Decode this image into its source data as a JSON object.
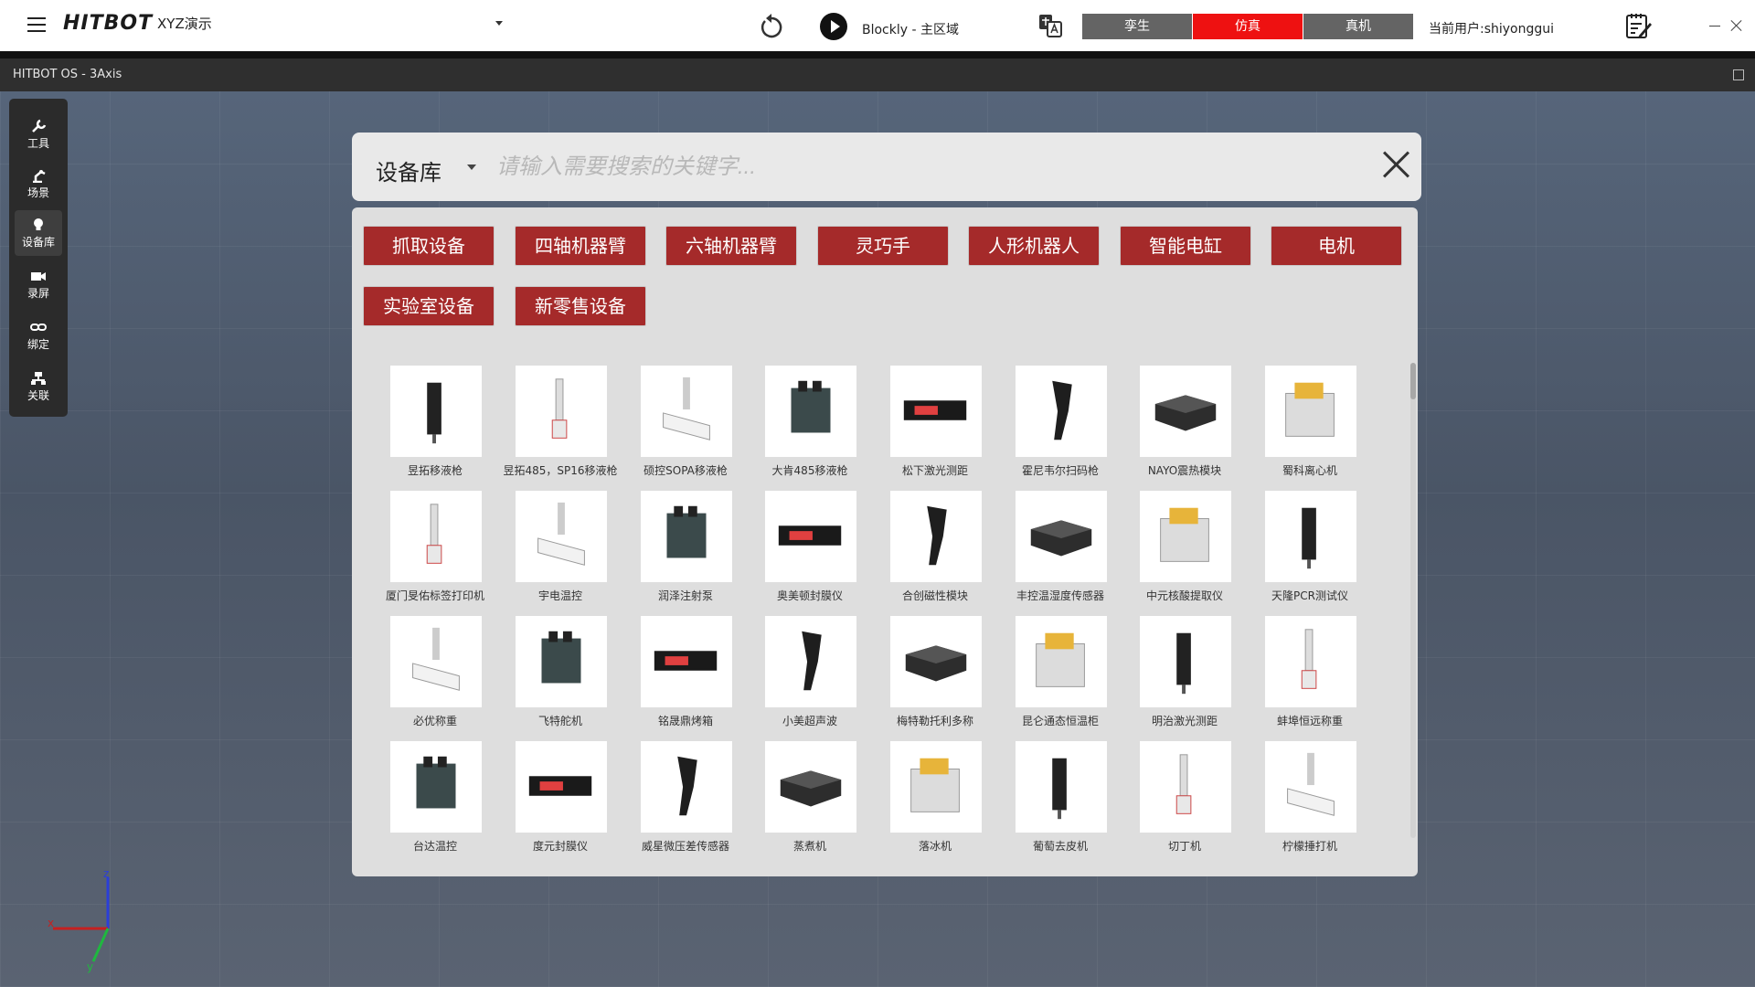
{
  "topbar": {
    "brand": "HITBOT",
    "project": "XYZ演示",
    "blockly": "Blockly - 主区域",
    "modes": [
      "孪生",
      "仿真",
      "真机"
    ],
    "active_mode": "仿真",
    "current_user": "当前用户:shiyonggui"
  },
  "subheader": {
    "title": "HITBOT OS - 3Axis"
  },
  "toolbar": {
    "items": [
      {
        "label": "工具",
        "icon": "wrench-icon"
      },
      {
        "label": "场景",
        "icon": "robot-arm-icon"
      },
      {
        "label": "设备库",
        "icon": "lightbulb-icon"
      },
      {
        "label": "录屏",
        "icon": "video-camera-icon"
      },
      {
        "label": "绑定",
        "icon": "link-icon"
      },
      {
        "label": "关联",
        "icon": "relation-icon"
      }
    ],
    "active": "设备库"
  },
  "axis": {
    "x": "x",
    "y": "y",
    "z": "z"
  },
  "library": {
    "selector": "设备库",
    "search_placeholder": "请输入需要搜索的关键字...",
    "categories": [
      "抓取设备",
      "四轴机器臂",
      "六轴机器臂",
      "灵巧手",
      "人形机器人",
      "智能电缸",
      "电机",
      "实验室设备",
      "新零售设备"
    ],
    "items": [
      "昱拓移液枪",
      "昱拓485，SP16移液枪",
      "硕控SOPA移液枪",
      "大肯485移液枪",
      "松下激光测距",
      "霍尼韦尔扫码枪",
      "NAYO震热模块",
      "蜀科离心机",
      "厦门旻佑标签打印机",
      "宇电温控",
      "润泽注射泵",
      "奥美顿封膜仪",
      "合创磁性模块",
      "丰控温湿度传感器",
      "中元核酸提取仪",
      "天隆PCR测试仪",
      "必优称重",
      "飞特舵机",
      "铭晟鼎烤箱",
      "小美超声波",
      "梅特勒托利多称",
      "昆仑通态恒温柜",
      "明治激光测距",
      "蚌埠恒远称重",
      "台达温控",
      "度元封膜仪",
      "威星微压差传感器",
      "蒸煮机",
      "落冰机",
      "葡萄去皮机",
      "切丁机",
      "柠檬捶打机"
    ]
  },
  "colors": {
    "accent": "#ee1111",
    "category_bg": "#a52a2a",
    "mode_bg": "#646464"
  }
}
